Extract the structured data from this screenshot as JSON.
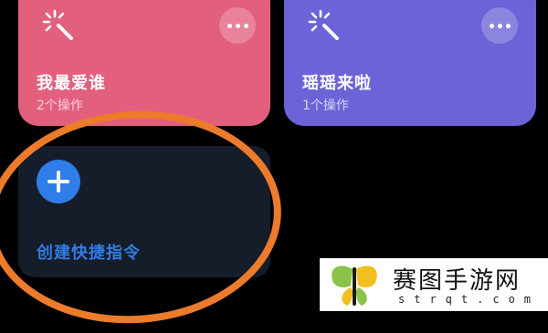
{
  "shortcuts": [
    {
      "title": "我最爱谁",
      "subtitle": "2个操作",
      "color": "#e35f7e",
      "icon": "magic-wand-icon"
    },
    {
      "title": "瑶瑶来啦",
      "subtitle": "1个操作",
      "color": "#6c63d8",
      "icon": "magic-wand-icon"
    }
  ],
  "create": {
    "label": "创建快捷指令",
    "icon": "plus-icon",
    "accent": "#2f7de8"
  },
  "highlight": {
    "color": "#ec7b2b"
  },
  "watermark": {
    "title": "赛图手游网",
    "url": "strqt.com"
  }
}
